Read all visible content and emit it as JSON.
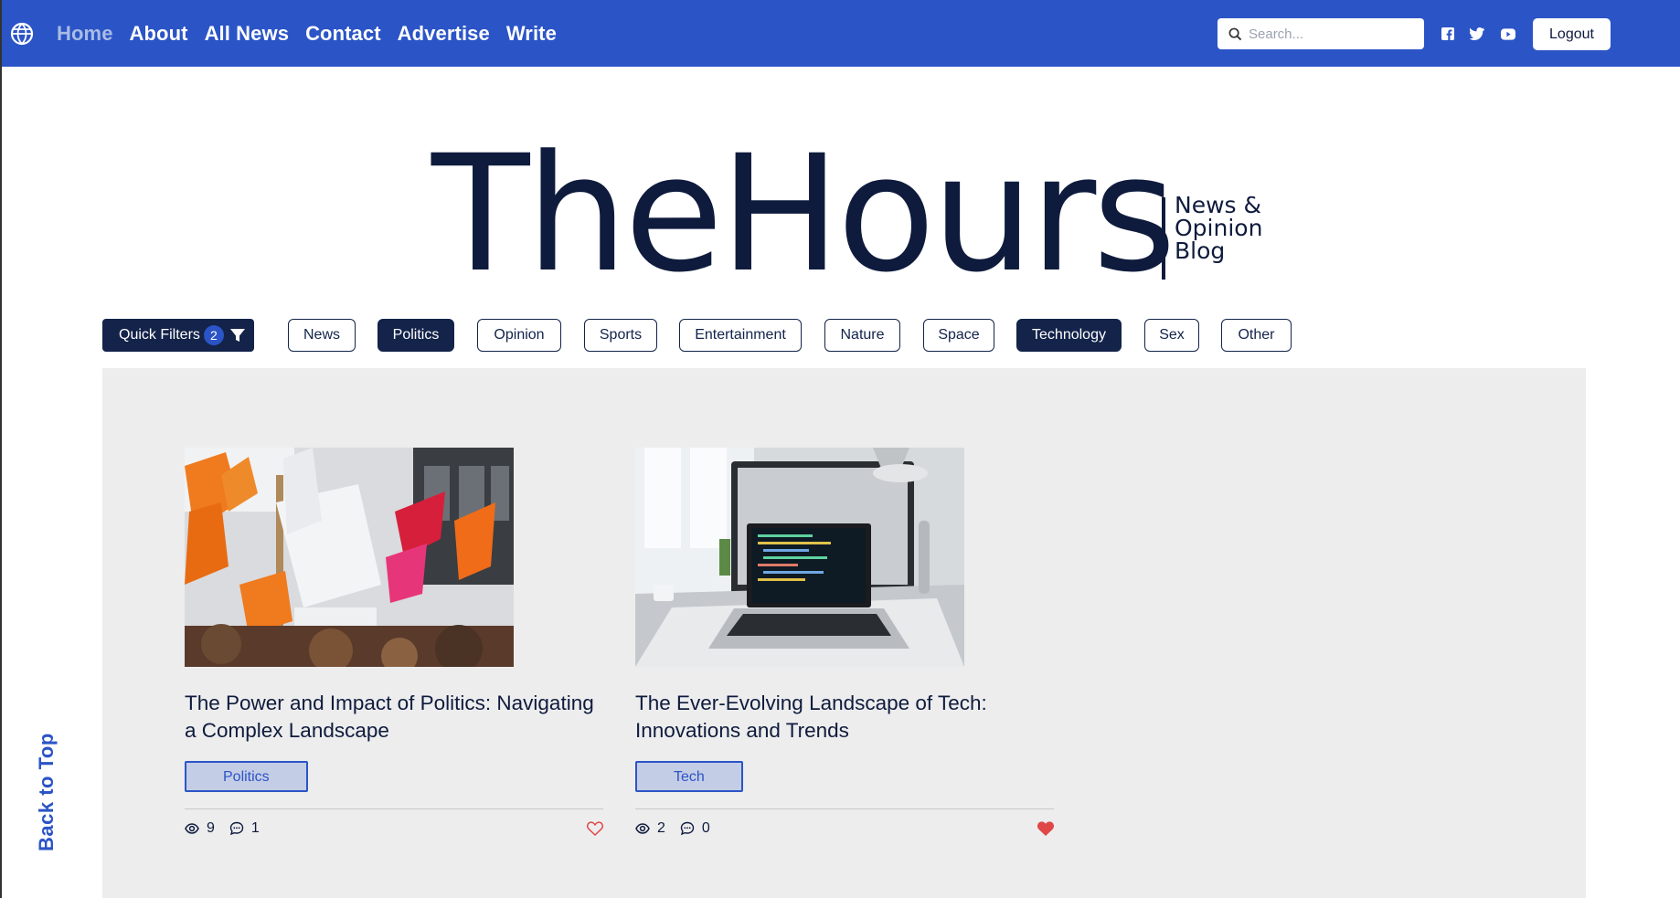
{
  "nav": {
    "links": [
      "Home",
      "About",
      "All News",
      "Contact",
      "Advertise",
      "Write"
    ],
    "search_placeholder": "Search...",
    "logout_label": "Logout",
    "social_icons": [
      "facebook-icon",
      "twitter-icon",
      "youtube-icon"
    ]
  },
  "brand": {
    "title": "TheHours",
    "subtitle_lines": [
      "News &",
      "Opinion",
      "Blog"
    ]
  },
  "filters": {
    "quick_label": "Quick Filters",
    "quick_count": "2",
    "chips": [
      {
        "label": "News",
        "selected": false
      },
      {
        "label": "Politics",
        "selected": true
      },
      {
        "label": "Opinion",
        "selected": false
      },
      {
        "label": "Sports",
        "selected": false
      },
      {
        "label": "Entertainment",
        "selected": false
      },
      {
        "label": "Nature",
        "selected": false
      },
      {
        "label": "Space",
        "selected": false
      },
      {
        "label": "Technology",
        "selected": true
      },
      {
        "label": "Sex",
        "selected": false
      },
      {
        "label": "Other",
        "selected": false
      }
    ]
  },
  "articles": [
    {
      "title": "The Power and Impact of Politics: Navigating a Complex Landscape",
      "tag": "Politics",
      "views": "9",
      "comments": "1",
      "liked": false
    },
    {
      "title": "The Ever-Evolving Landscape of Tech: Innovations and Trends",
      "tag": "Tech",
      "views": "2",
      "comments": "0",
      "liked": true
    }
  ],
  "back_to_top": "Back to Top",
  "colors": {
    "primary": "#2b54c6",
    "navy": "#13234a",
    "like": "#e04848",
    "panel": "#ededee"
  }
}
